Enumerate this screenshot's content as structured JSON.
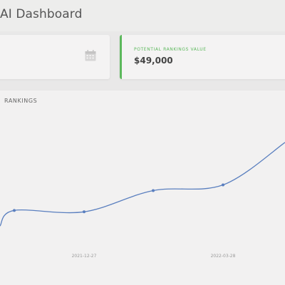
{
  "header": {
    "title": "AI Dashboard"
  },
  "cards": [
    {
      "icon": "calendar-icon"
    },
    {
      "label": "POTENTIAL RANKINGS VALUE",
      "value": "$49,000",
      "accent": "#5cb85c"
    }
  ],
  "chart_section": {
    "title": "RANKINGS"
  },
  "chart_data": {
    "type": "line",
    "x_tick_labels": [
      "2021-12-27",
      "2022-03-28"
    ],
    "series": [
      {
        "color": "#5a7fbf",
        "points": [
          [
            1,
            34
          ],
          [
            2,
            45
          ],
          [
            3,
            44
          ],
          [
            4,
            59
          ],
          [
            5,
            63
          ],
          [
            6,
            93
          ]
        ]
      }
    ],
    "ylim": [
      20,
      100
    ],
    "grid": false
  }
}
